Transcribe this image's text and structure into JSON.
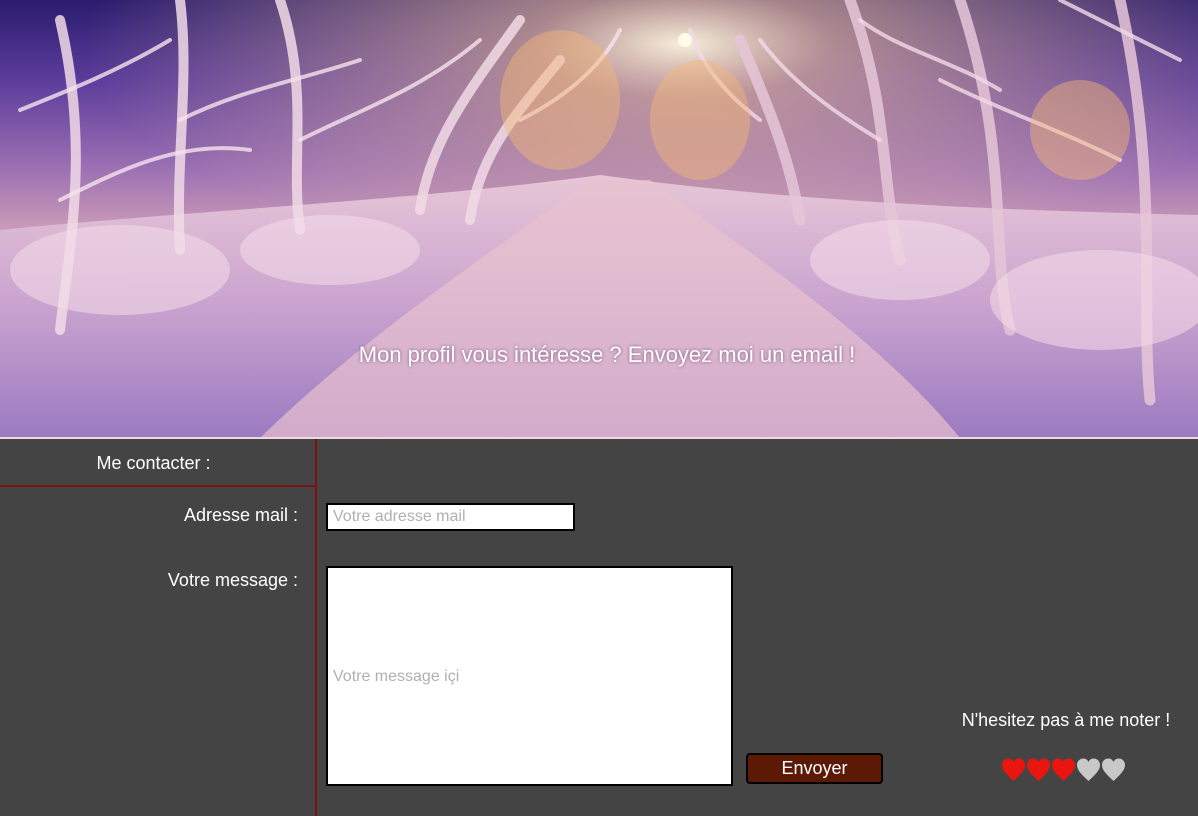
{
  "hero": {
    "caption": "Mon profil vous intéresse ? Envoyez moi un email !"
  },
  "contact": {
    "title": "Me contacter :",
    "email_label": "Adresse mail :",
    "email_placeholder": "Votre adresse mail",
    "email_value": "",
    "message_label": "Votre message :",
    "message_placeholder": "Votre message içi",
    "message_value": "",
    "send_label": "Envoyer"
  },
  "rating": {
    "prompt": "N'hesitez pas à me noter !",
    "value": 3,
    "max": 5,
    "icon": "heart-icon",
    "filled_color": "#e8160f",
    "empty_color": "#c8c8c8"
  },
  "colors": {
    "panel_background": "#444444",
    "divider": "#7a1212",
    "button_background": "#5c1a06"
  }
}
